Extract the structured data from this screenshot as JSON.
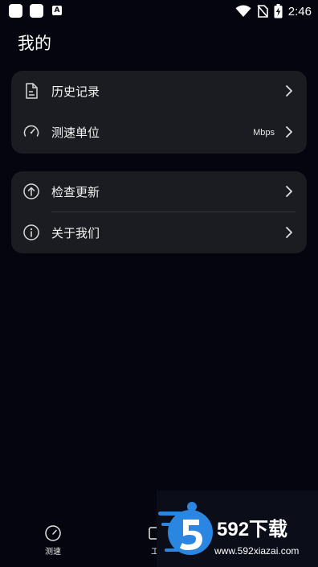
{
  "status_bar": {
    "time": "2:46",
    "a_badge": "A"
  },
  "page": {
    "title": "我的"
  },
  "group1": [
    {
      "label": "历史记录",
      "value": "",
      "icon": "document-icon"
    },
    {
      "label": "测速单位",
      "value": "Mbps",
      "icon": "speedometer-icon"
    }
  ],
  "group2": [
    {
      "label": "检查更新",
      "value": "",
      "icon": "upload-circle-icon"
    },
    {
      "label": "关于我们",
      "value": "",
      "icon": "info-circle-icon"
    }
  ],
  "bottom_nav": [
    {
      "label": "测速",
      "icon": "speedometer-icon"
    },
    {
      "label": "工",
      "icon": "tool-icon"
    }
  ],
  "watermark": {
    "brand": "592下载",
    "url": "www.592xiazai.com"
  },
  "colors": {
    "background": "#05050f",
    "card": "#1b1c22",
    "watermark_blue": "#2a86e0"
  }
}
